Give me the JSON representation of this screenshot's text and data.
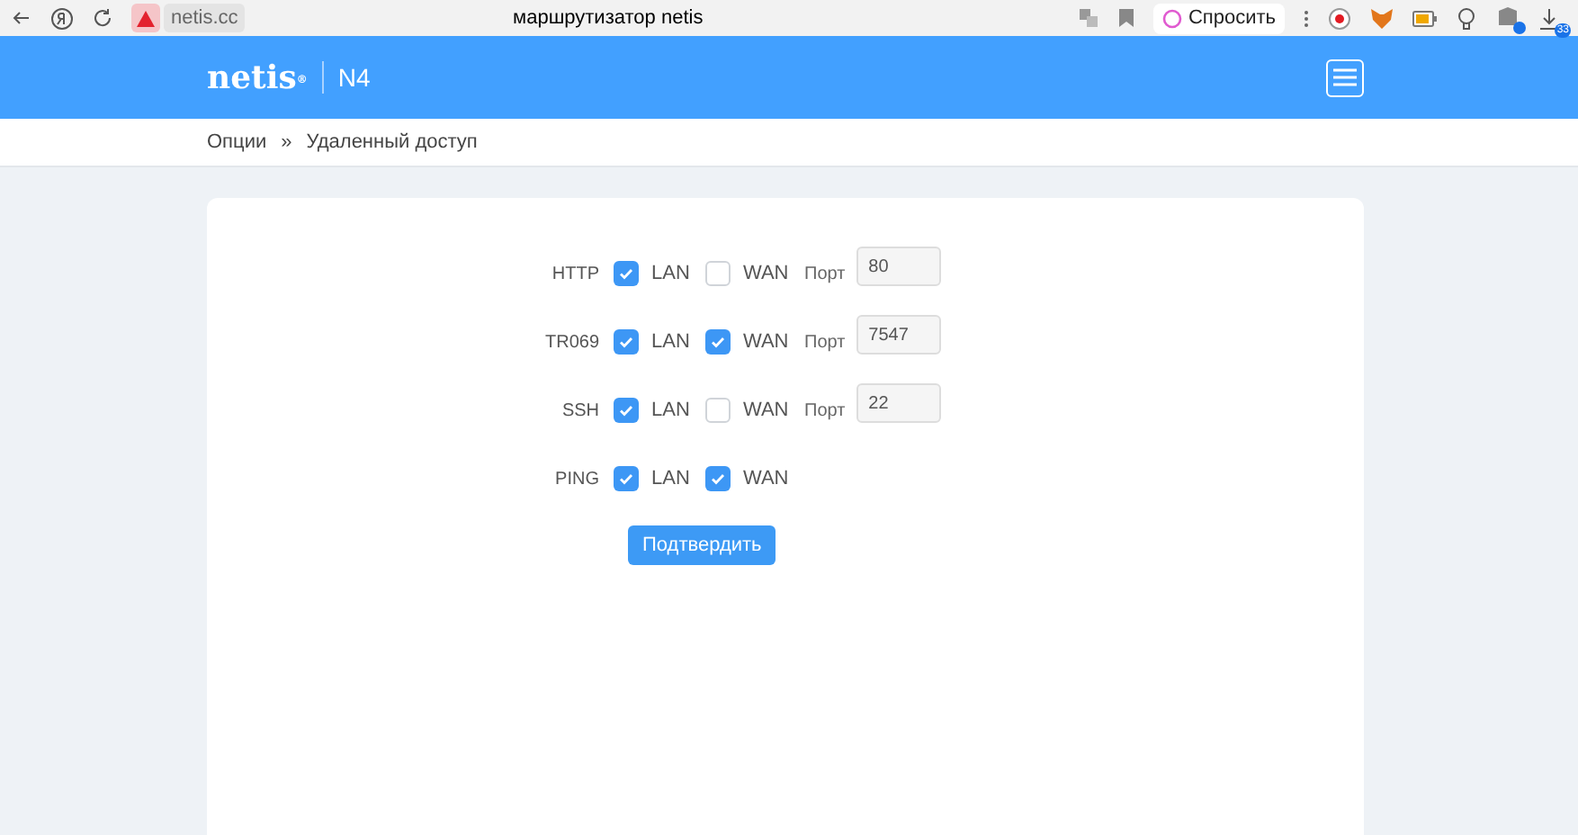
{
  "browser": {
    "url": "netis.cc",
    "title": "маршрутизатор netis",
    "ask_button": "Спросить",
    "download_badge": "33"
  },
  "header": {
    "logo": "netis",
    "logo_mark": "®",
    "model": "N4"
  },
  "breadcrumb": [
    "Опции",
    "»",
    "Удаленный доступ"
  ],
  "rows": [
    {
      "label": "HTTP",
      "lan": {
        "label": "LAN",
        "checked": true
      },
      "wan": {
        "label": "WAN",
        "checked": false
      },
      "port": {
        "label": "Порт",
        "value": "80"
      }
    },
    {
      "label": "TR069",
      "lan": {
        "label": "LAN",
        "checked": true
      },
      "wan": {
        "label": "WAN",
        "checked": true
      },
      "port": {
        "label": "Порт",
        "value": "7547"
      }
    },
    {
      "label": "SSH",
      "lan": {
        "label": "LAN",
        "checked": true
      },
      "wan": {
        "label": "WAN",
        "checked": false
      },
      "port": {
        "label": "Порт",
        "value": "22"
      }
    },
    {
      "label": "PING",
      "lan": {
        "label": "LAN",
        "checked": true
      },
      "wan": {
        "label": "WAN",
        "checked": true
      }
    }
  ],
  "submit": "Подтвердить"
}
